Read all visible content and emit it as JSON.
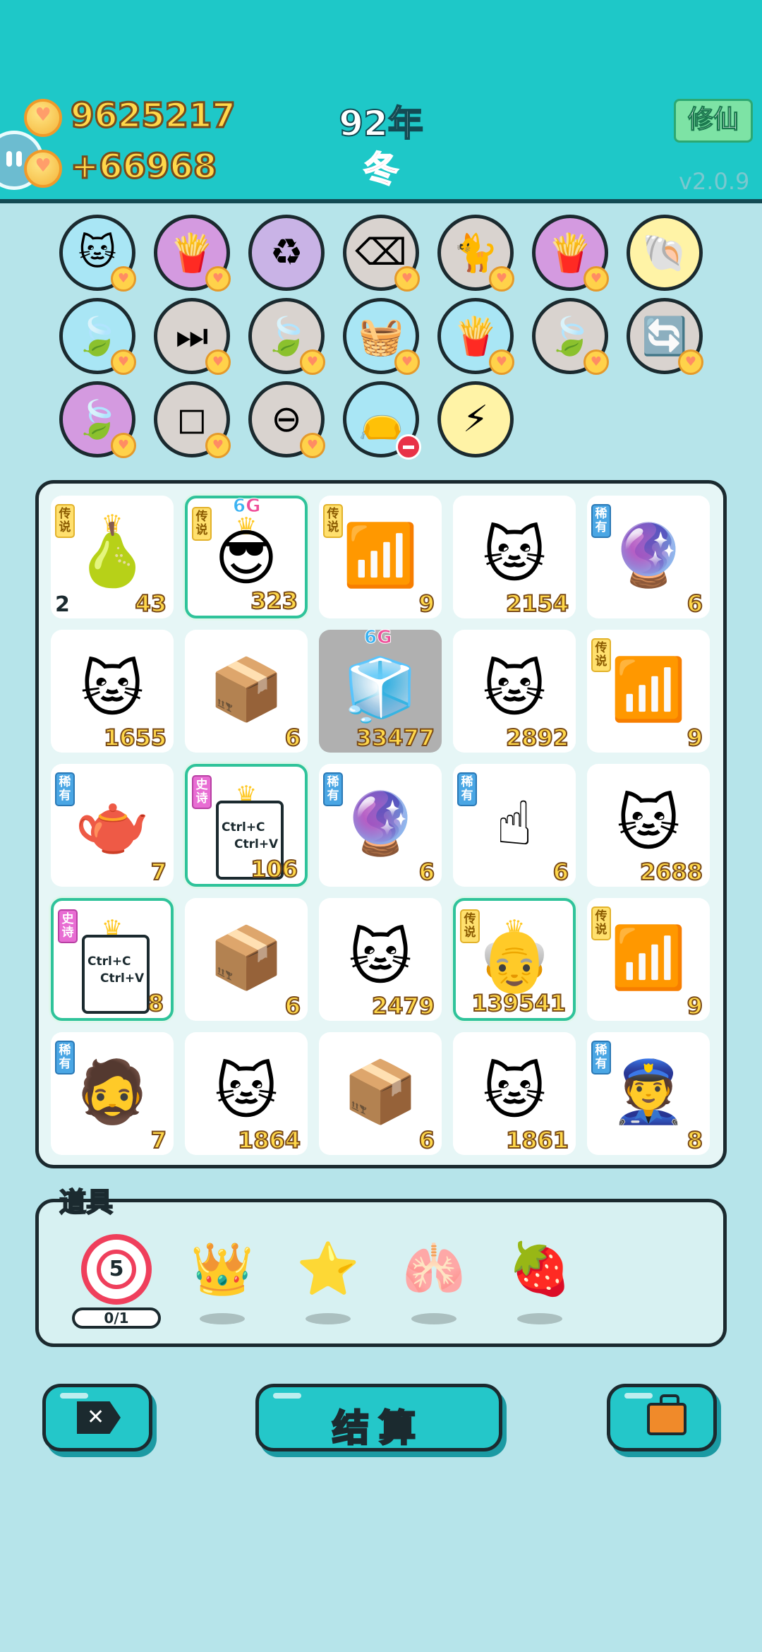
{
  "header": {
    "money": "9625217",
    "income": "+66968",
    "year": "92年",
    "season": "冬",
    "mode_button": "修仙",
    "version": "v2.0.9"
  },
  "relics": [
    {
      "name": "cat-relic",
      "glyph": "🐱",
      "bg": "#a9e6f5",
      "badge": "heart"
    },
    {
      "name": "fries-relic",
      "glyph": "🍟",
      "bg": "#d49ae0",
      "badge": "heart"
    },
    {
      "name": "recycle-relic",
      "glyph": "♻",
      "bg": "#c9b3e6",
      "badge": "none"
    },
    {
      "name": "delete-tag-relic",
      "glyph": "⌫",
      "bg": "#d9d3cf",
      "badge": "heart"
    },
    {
      "name": "twin-cats-relic",
      "glyph": "🐈",
      "bg": "#d9d3cf",
      "badge": "heart"
    },
    {
      "name": "fries-relic",
      "glyph": "🍟",
      "bg": "#d49ae0",
      "badge": "heart"
    },
    {
      "name": "shell-relic",
      "glyph": "🐚",
      "bg": "#fff3a6",
      "badge": "none"
    },
    {
      "name": "leaf-relic",
      "glyph": "🍃",
      "bg": "#a9e6f5",
      "badge": "heart"
    },
    {
      "name": "skip-relic",
      "glyph": "⏭",
      "bg": "#d9d3cf",
      "badge": "heart"
    },
    {
      "name": "leaf-relic",
      "glyph": "🍃",
      "bg": "#d9d3cf",
      "badge": "heart"
    },
    {
      "name": "fruit-basket-relic",
      "glyph": "🧺",
      "bg": "#a9e6f5",
      "badge": "heart"
    },
    {
      "name": "fries-relic",
      "glyph": "🍟",
      "bg": "#a9e6f5",
      "badge": "heart"
    },
    {
      "name": "leaf-relic",
      "glyph": "🍃",
      "bg": "#d9d3cf",
      "badge": "heart"
    },
    {
      "name": "refresh-relic",
      "glyph": "🔄",
      "bg": "#d9d3cf",
      "badge": "heart"
    },
    {
      "name": "leaf-relic",
      "glyph": "🍃",
      "bg": "#d49ae0",
      "badge": "heart"
    },
    {
      "name": "sugar-cubes-relic",
      "glyph": "◻",
      "bg": "#d9d3cf",
      "badge": "heart"
    },
    {
      "name": "remove-relic",
      "glyph": "⊖",
      "bg": "#d9d3cf",
      "badge": "heart"
    },
    {
      "name": "sack-relic",
      "glyph": "👝",
      "bg": "#a9e6f5",
      "badge": "minus"
    },
    {
      "name": "lightning-relic",
      "glyph": "⚡",
      "bg": "#fff3a6",
      "badge": "none"
    }
  ],
  "cells": [
    {
      "name": "pomelo",
      "glyph": "🍐",
      "tag": "传说",
      "tagType": "legend",
      "value": "43",
      "count": "2",
      "crown": true,
      "glow": false,
      "sixg": false
    },
    {
      "name": "sunglasses-guy",
      "glyph": "😎",
      "tag": "传说",
      "tagType": "legend",
      "value": "323",
      "crown": true,
      "glow": true,
      "sixg": true
    },
    {
      "name": "wifi",
      "glyph": "📶",
      "tag": "传说",
      "tagType": "legend",
      "value": "9"
    },
    {
      "name": "cat",
      "glyph": "🐱",
      "value": "2154"
    },
    {
      "name": "gacha-ball",
      "glyph": "🔮",
      "tag": "稀有",
      "tagType": "rare",
      "value": "6"
    },
    {
      "name": "cat",
      "glyph": "🐱",
      "value": "1655"
    },
    {
      "name": "parcel",
      "glyph": "📦",
      "value": "6"
    },
    {
      "name": "fridge",
      "glyph": "🧊",
      "value": "33477",
      "gray": true,
      "sixg": true
    },
    {
      "name": "cat",
      "glyph": "🐱",
      "value": "2892"
    },
    {
      "name": "wifi",
      "glyph": "📶",
      "tag": "传说",
      "tagType": "legend",
      "value": "9"
    },
    {
      "name": "teapot",
      "glyph": "🫖",
      "tag": "稀有",
      "tagType": "rare",
      "value": "7"
    },
    {
      "name": "copy-paste",
      "glyph": "",
      "tag": "史诗",
      "tagType": "epic",
      "value": "106",
      "crown": true,
      "glow": true,
      "ctrl": true
    },
    {
      "name": "gacha-ball",
      "glyph": "🔮",
      "tag": "稀有",
      "tagType": "rare",
      "value": "6"
    },
    {
      "name": "finger",
      "glyph": "☝",
      "tag": "稀有",
      "tagType": "rare",
      "value": "6"
    },
    {
      "name": "cat",
      "glyph": "🐱",
      "value": "2688"
    },
    {
      "name": "copy-paste",
      "glyph": "",
      "tag": "史诗",
      "tagType": "epic",
      "value": "8",
      "crown": true,
      "glow": true,
      "ctrl": true
    },
    {
      "name": "parcel",
      "glyph": "📦",
      "value": "6"
    },
    {
      "name": "cat",
      "glyph": "🐱",
      "value": "2479"
    },
    {
      "name": "old-man",
      "glyph": "👴",
      "tag": "传说",
      "tagType": "legend",
      "value": "139541",
      "crown": true,
      "glow": true
    },
    {
      "name": "wifi",
      "glyph": "📶",
      "tag": "传说",
      "tagType": "legend",
      "value": "9"
    },
    {
      "name": "bucket-hat-guy",
      "glyph": "🧔",
      "tag": "稀有",
      "tagType": "rare",
      "value": "7"
    },
    {
      "name": "cat",
      "glyph": "🐱",
      "value": "1864"
    },
    {
      "name": "parcel",
      "glyph": "📦",
      "value": "6"
    },
    {
      "name": "cat",
      "glyph": "🐱",
      "value": "1861"
    },
    {
      "name": "police-officer",
      "glyph": "👮",
      "tag": "稀有",
      "tagType": "rare",
      "value": "8"
    }
  ],
  "ctrl_text": {
    "line1": "Ctrl+C",
    "line2": "Ctrl+V"
  },
  "items": {
    "title": "道具",
    "target_number": "5",
    "target_uses": "0/1",
    "list": [
      {
        "name": "crown-item",
        "glyph": "👑"
      },
      {
        "name": "star-item",
        "glyph": "⭐"
      },
      {
        "name": "liver-item",
        "glyph": "🫁"
      },
      {
        "name": "lychee-item",
        "glyph": "🍓"
      }
    ]
  },
  "buttons": {
    "settle": "结算"
  }
}
